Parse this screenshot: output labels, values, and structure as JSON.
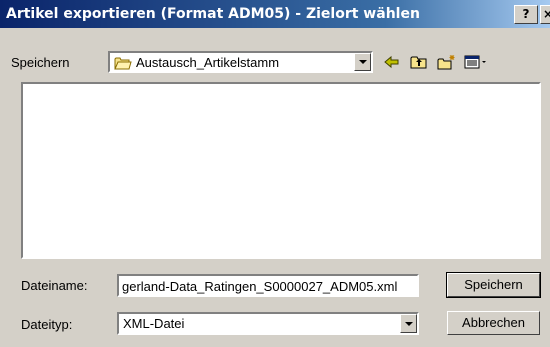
{
  "window": {
    "title": "Artikel exportieren (Format ADM05) - Zielort wählen",
    "help_label": "?",
    "close_label": "×"
  },
  "location": {
    "label": "Speichern",
    "folder": "Austausch_Artikelstamm"
  },
  "toolbar": {
    "icons": [
      "back-arrow-icon",
      "up-folder-icon",
      "new-folder-icon",
      "view-menu-icon"
    ]
  },
  "filename": {
    "label": "Dateiname:",
    "value": "gerland-Data_Ratingen_S0000027_ADM05.xml"
  },
  "filetype": {
    "label": "Dateityp:",
    "value": "XML-Datei"
  },
  "buttons": {
    "save_label": "Speichern",
    "cancel_label": "Abbrechen"
  },
  "colors": {
    "title_gradient_start": "#0a246a",
    "title_gradient_end": "#a6caf0",
    "face": "#d4d0c8",
    "back_arrow": "#c0c000"
  }
}
